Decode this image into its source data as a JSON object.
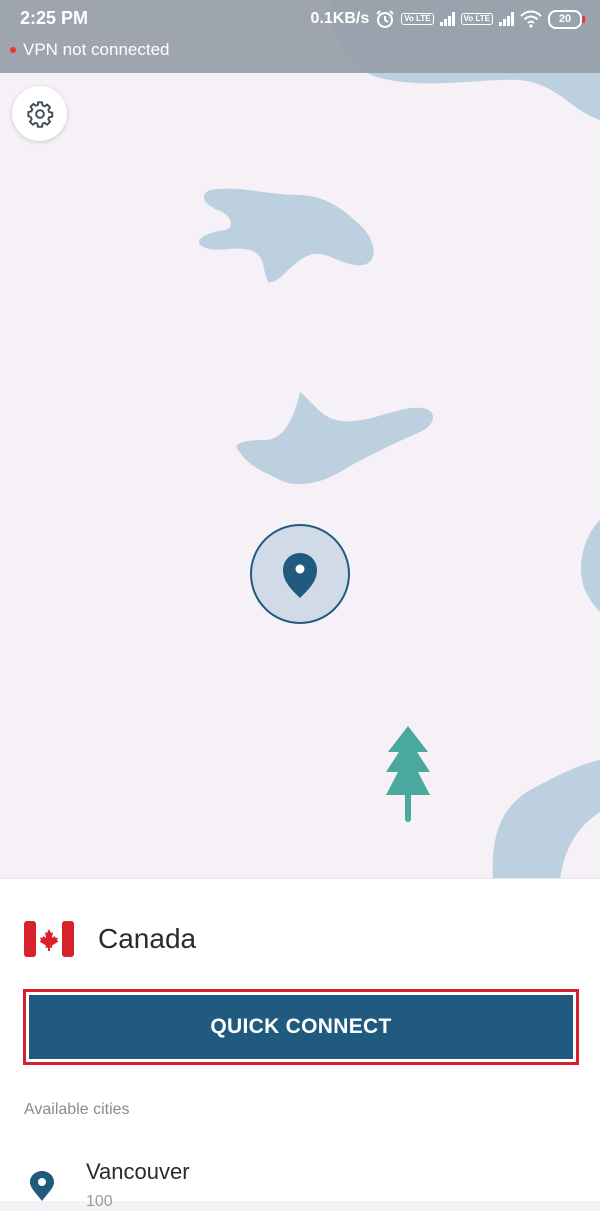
{
  "status_bar": {
    "time": "2:25 PM",
    "vpn_status": "VPN not connected",
    "network_speed": "0.1KB/s",
    "volte_label": "Vo LTE",
    "battery": "20",
    "icons": [
      "alarm-icon",
      "volte-icon",
      "signal-icon",
      "wifi-icon",
      "battery-icon"
    ]
  },
  "map": {
    "icons": [
      "settings-gear-icon",
      "location-pin-icon",
      "pine-tree-icon"
    ],
    "colors": {
      "background": "#f6f1f6",
      "water": "#bdd0e0",
      "pin": "#205a7f",
      "tree": "#4aa89e"
    }
  },
  "panel": {
    "country": "Canada",
    "country_flag": "canada-flag-icon",
    "quick_connect_label": "QUICK CONNECT",
    "available_cities_label": "Available cities",
    "cities": [
      {
        "name": "Vancouver",
        "sub": "100"
      }
    ],
    "colors": {
      "button": "#205a7f",
      "highlight_border": "#d7222b"
    }
  }
}
